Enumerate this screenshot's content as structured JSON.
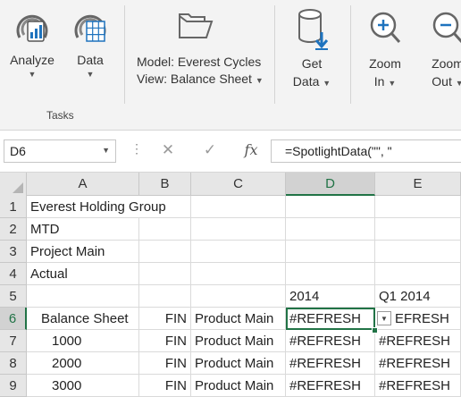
{
  "ribbon": {
    "analyze_label": "Analyze",
    "data_label": "Data",
    "model_text": "Model: Everest Cycles",
    "view_text": "View: Balance Sheet",
    "get_data_line1": "Get",
    "get_data_line2": "Data",
    "zoom_in_line1": "Zoom",
    "zoom_in_line2": "In",
    "zoom_out_line1": "Zoom",
    "zoom_out_line2": "Out",
    "group_label": "Tasks",
    "accent_color": "#1e73be"
  },
  "formula_bar": {
    "name_box": "D6",
    "cancel_symbol": "✕",
    "enter_symbol": "✓",
    "fx_symbol": "fx",
    "formula": "=SpotlightData(\"\", \""
  },
  "sheet": {
    "columns": [
      "A",
      "B",
      "C",
      "D",
      "E"
    ],
    "rows": [
      "1",
      "2",
      "3",
      "4",
      "5",
      "6",
      "7",
      "8",
      "9"
    ],
    "active_cell": "D6",
    "cells": {
      "A1": "Everest Holding Group",
      "A2": "MTD",
      "A3": "Project Main",
      "A4": "Actual",
      "D5": "2014",
      "E5": "Q1 2014",
      "A6": "Balance Sheet",
      "B6": "FIN",
      "C6": "Product Main",
      "D6": "#REFRESH",
      "E6": "EFRESH",
      "A7": "1000",
      "B7": "FIN",
      "C7": "Product Main",
      "D7": "#REFRESH",
      "E7": "#REFRESH",
      "A8": "2000",
      "B8": "FIN",
      "C8": "Product Main",
      "D8": "#REFRESH",
      "E8": "#REFRESH",
      "A9": "3000",
      "B9": "FIN",
      "C9": "Product Main",
      "D9": "#REFRESH",
      "E9": "#REFRESH"
    }
  }
}
